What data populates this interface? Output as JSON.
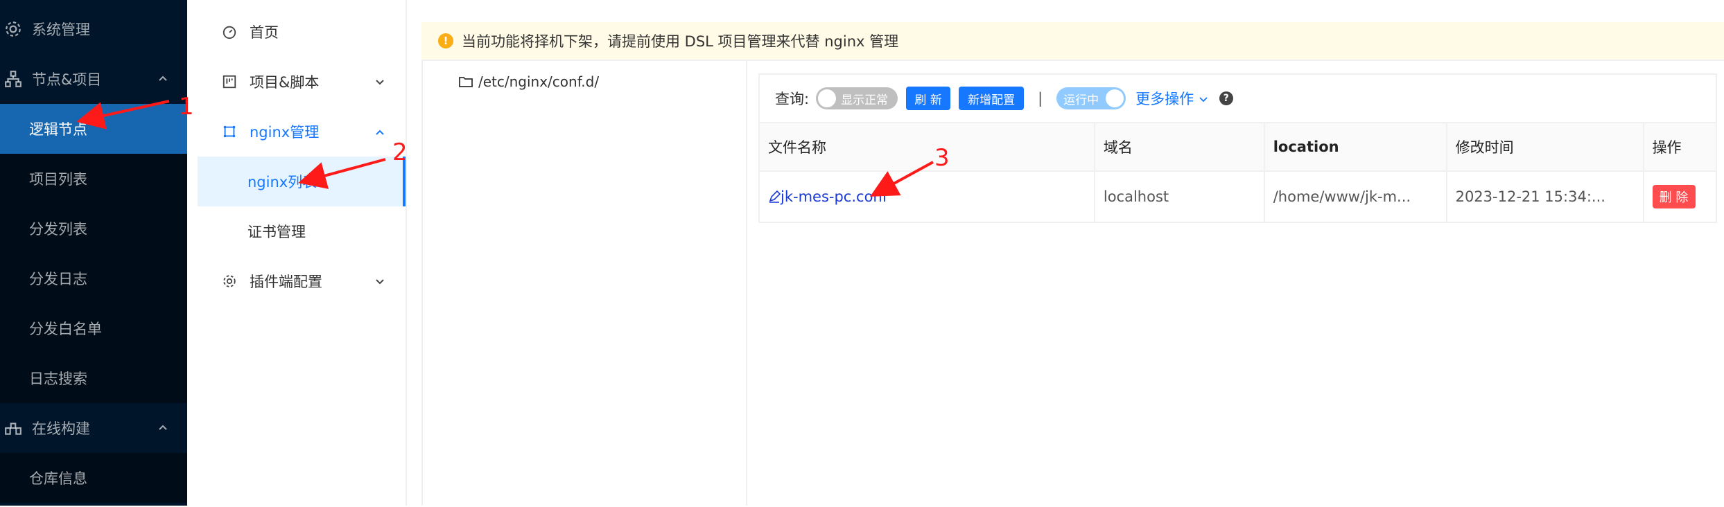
{
  "sidebar": {
    "items": [
      {
        "label": "系统管理",
        "icon": "gear-icon"
      },
      {
        "label": "节点&项目",
        "icon": "sitemap-icon",
        "expanded": true
      },
      {
        "label": "逻辑节点",
        "active": true
      },
      {
        "label": "项目列表"
      },
      {
        "label": "分发列表"
      },
      {
        "label": "分发日志"
      },
      {
        "label": "分发白名单"
      },
      {
        "label": "日志搜索"
      },
      {
        "label": "在线构建",
        "icon": "build-icon",
        "expanded": true
      },
      {
        "label": "仓库信息"
      }
    ]
  },
  "menu2": {
    "items": [
      {
        "label": "首页",
        "icon": "dashboard-icon"
      },
      {
        "label": "项目&脚本",
        "icon": "project-icon"
      },
      {
        "label": "nginx管理",
        "icon": "nginx-icon",
        "expanded": true
      },
      {
        "label": "nginx列表",
        "active": true
      },
      {
        "label": "证书管理"
      },
      {
        "label": "插件端配置",
        "icon": "gear-icon"
      }
    ]
  },
  "notice": {
    "text": "当前功能将择机下架，请提前使用 DSL 项目管理来代替 nginx 管理",
    "icon": "exclamation-icon"
  },
  "tree": {
    "path": "/etc/nginx/conf.d/",
    "icon": "folder-icon"
  },
  "toolbar": {
    "query_label": "查询:",
    "show_normal_label": "显示正常",
    "refresh_label": "刷 新",
    "add_config_label": "新增配置",
    "separator": "|",
    "running_label": "运行中",
    "more_label": "更多操作",
    "help_icon": "question-icon"
  },
  "table": {
    "columns": [
      "文件名称",
      "域名",
      "location",
      "修改时间",
      "操作"
    ],
    "rows": [
      {
        "name": "jk-mes-pc.conf",
        "domain": "localhost",
        "location": "/home/www/jk-m...",
        "mtime": "2023-12-21 15:34:...",
        "action": "删 除"
      }
    ]
  },
  "annotations": [
    "1",
    "2",
    "3"
  ],
  "colors": {
    "sidebar_bg": "#001529",
    "active_blue": "#1677ff",
    "notice_bg": "#fffbe6",
    "arrow_red": "#ff1a1a"
  }
}
